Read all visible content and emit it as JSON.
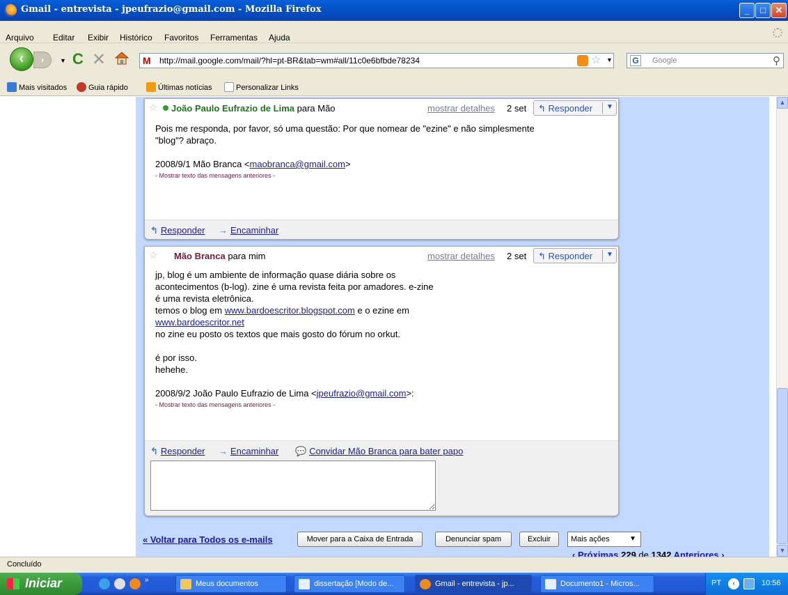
{
  "window": {
    "title": "Gmail - entrevista - jpeufrazio@gmail.com - Mozilla Firefox"
  },
  "menu": [
    "Arquivo",
    "Editar",
    "Exibir",
    "Histórico",
    "Favoritos",
    "Ferramentas",
    "Ajuda"
  ],
  "nav": {
    "url": "http://mail.google.com/mail/?hl=pt-BR&tab=wm#all/11c0e6bfbde78234",
    "search_placeholder": "Google",
    "search_engine": "G",
    "site_icon": "M"
  },
  "bookmarks": [
    {
      "label": "Mais visitados",
      "color": "#3a7bd5"
    },
    {
      "label": "Guia rápido",
      "color": "#c0392b"
    },
    {
      "label": "Últimas notícias",
      "color": "#f39c12"
    },
    {
      "label": "Personalizar Links",
      "color": "#ffffff"
    }
  ],
  "messages": [
    {
      "sender": "João Paulo Eufrazio de Lima",
      "to": "para Mão",
      "details": "mostrar detalhes",
      "date": "2 set",
      "reply_label": "Responder",
      "body": [
        "Pois me responda, por favor, só uma questão: Por que nomear de \"ezine\" e não simplesmente",
        "\"blog\"? abraço."
      ],
      "quote_intro": "2008/9/1 Mão Branca <",
      "quote_email": "maobranca@gmail.com",
      "quote_outro": ">",
      "show_quoted": "- Mostrar texto das mensagens anteriores -",
      "footer": {
        "reply": "Responder",
        "forward": "Encaminhar"
      }
    },
    {
      "sender": "Mão Branca",
      "to": "para mim",
      "details": "mostrar detalhes",
      "date": "2 set",
      "reply_label": "Responder",
      "body": [
        "jp, blog é um ambiente de informação quase diária sobre os",
        "acontecimentos (b-log). zine é uma revista feita por amadores. e-zine",
        "é uma revista eletrônica."
      ],
      "line_blog_pre": "temos o blog em ",
      "link_blog": "www.bardoescritor.blogspot.com",
      "line_blog_post": " e o ezine em",
      "link_site": "www.bardoescritor.net",
      "body2": [
        "no zine eu posto os textos que mais gosto do fórum no orkut."
      ],
      "body3": [
        "é por isso.",
        "hehehe."
      ],
      "quote_intro": "2008/9/2 João Paulo Eufrazio de Lima <",
      "quote_email": "jpeufrazio@gmail.com",
      "quote_outro": ">:",
      "show_quoted": "- Mostrar texto das mensagens anteriores -",
      "footer": {
        "reply": "Responder",
        "forward": "Encaminhar",
        "chat": "Convidar Mão Branca para bater papo"
      }
    }
  ],
  "actions": {
    "back": "« Voltar para Todos os e-mails",
    "move_inbox": "Mover para a Caixa de Entrada",
    "spam": "Denunciar spam",
    "delete": "Excluir",
    "more": "Mais ações",
    "prev": "‹ Próximas",
    "current": "229",
    "of": " de ",
    "total": "1342",
    "next": "Anteriores ›"
  },
  "status": "Concluído",
  "taskbar": {
    "start": "Iniciar",
    "tasks": [
      {
        "label": "Meus documentos",
        "color": "#f1c75a"
      },
      {
        "label": "dissertação [Modo de...",
        "color": "#e8eefc"
      },
      {
        "label": "Gmail - entrevista - jp...",
        "color": "#f08a1c"
      },
      {
        "label": "Documento1 - Micros...",
        "color": "#e8eefc"
      }
    ],
    "lang": "PT",
    "time": "10:56"
  }
}
